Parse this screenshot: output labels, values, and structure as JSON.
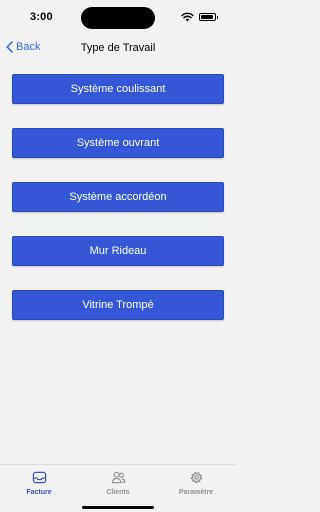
{
  "status_bar": {
    "time": "3:00",
    "battery_level": 0.95
  },
  "nav": {
    "back_label": "Back",
    "title": "Type de Travail"
  },
  "options": [
    {
      "label": "Système coulissant"
    },
    {
      "label": "Système ouvrant"
    },
    {
      "label": "Système accordéon"
    },
    {
      "label": "Mur Rideau"
    },
    {
      "label": "Vitrine Trompé"
    }
  ],
  "tabs": [
    {
      "label": "Facture",
      "icon": "inbox-icon",
      "active": true
    },
    {
      "label": "Clients",
      "icon": "people-icon",
      "active": false
    },
    {
      "label": "Paramètre",
      "icon": "gear-icon",
      "active": false
    }
  ],
  "colors": {
    "accent": "#2f6bd8",
    "button": "#3557d6",
    "active_tab": "#3a50b8",
    "inactive_tab": "#8e8e93",
    "background": "#f2f2f2"
  }
}
